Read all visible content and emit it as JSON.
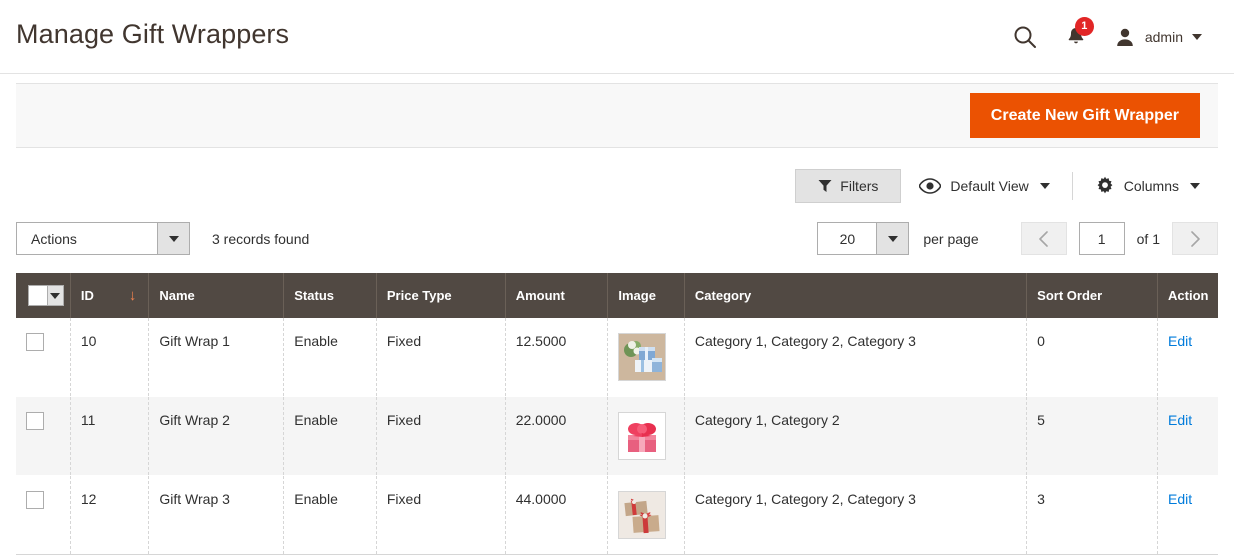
{
  "header": {
    "title": "Manage Gift Wrappers",
    "search_icon": "search-icon",
    "notifications_icon": "bell-icon",
    "notifications_count": "1",
    "user_icon": "user-avatar-icon",
    "user_name": "admin"
  },
  "page_actions": {
    "create_label": "Create New Gift Wrapper",
    "accent_color": "#eb5202"
  },
  "grid_controls": {
    "filters_label": "Filters",
    "filters_icon": "funnel-icon",
    "view_icon": "eye-icon",
    "view_label": "Default View",
    "columns_icon": "gear-icon",
    "columns_label": "Columns"
  },
  "toolbar": {
    "actions_label": "Actions",
    "records_found": "3 records found",
    "per_page_value": "20",
    "per_page_label": "per page",
    "prev_icon": "chevron-left-icon",
    "next_icon": "chevron-right-icon",
    "current_page": "1",
    "of_label": "of 1"
  },
  "table": {
    "columns": [
      {
        "label": "",
        "key": "check"
      },
      {
        "label": "ID",
        "key": "id",
        "sorted": "asc",
        "sort_arrow": "↓"
      },
      {
        "label": "Name",
        "key": "name"
      },
      {
        "label": "Status",
        "key": "status"
      },
      {
        "label": "Price Type",
        "key": "price_type"
      },
      {
        "label": "Amount",
        "key": "amount"
      },
      {
        "label": "Image",
        "key": "image"
      },
      {
        "label": "Category",
        "key": "category"
      },
      {
        "label": "Sort Order",
        "key": "sort_order"
      },
      {
        "label": "Action",
        "key": "action"
      }
    ],
    "rows": [
      {
        "id": "10",
        "name": "Gift Wrap 1",
        "status": "Enable",
        "price_type": "Fixed",
        "amount": "12.5000",
        "image_name": "gift-wrap-1-thumbnail",
        "category": "Category 1, Category 2, Category 3",
        "sort_order": "0",
        "action": "Edit"
      },
      {
        "id": "11",
        "name": "Gift Wrap 2",
        "status": "Enable",
        "price_type": "Fixed",
        "amount": "22.0000",
        "image_name": "gift-wrap-2-thumbnail",
        "category": "Category 1, Category 2",
        "sort_order": "5",
        "action": "Edit"
      },
      {
        "id": "12",
        "name": "Gift Wrap 3",
        "status": "Enable",
        "price_type": "Fixed",
        "amount": "44.0000",
        "image_name": "gift-wrap-3-thumbnail",
        "category": "Category 1, Category 2, Category 3",
        "sort_order": "3",
        "action": "Edit"
      }
    ]
  }
}
